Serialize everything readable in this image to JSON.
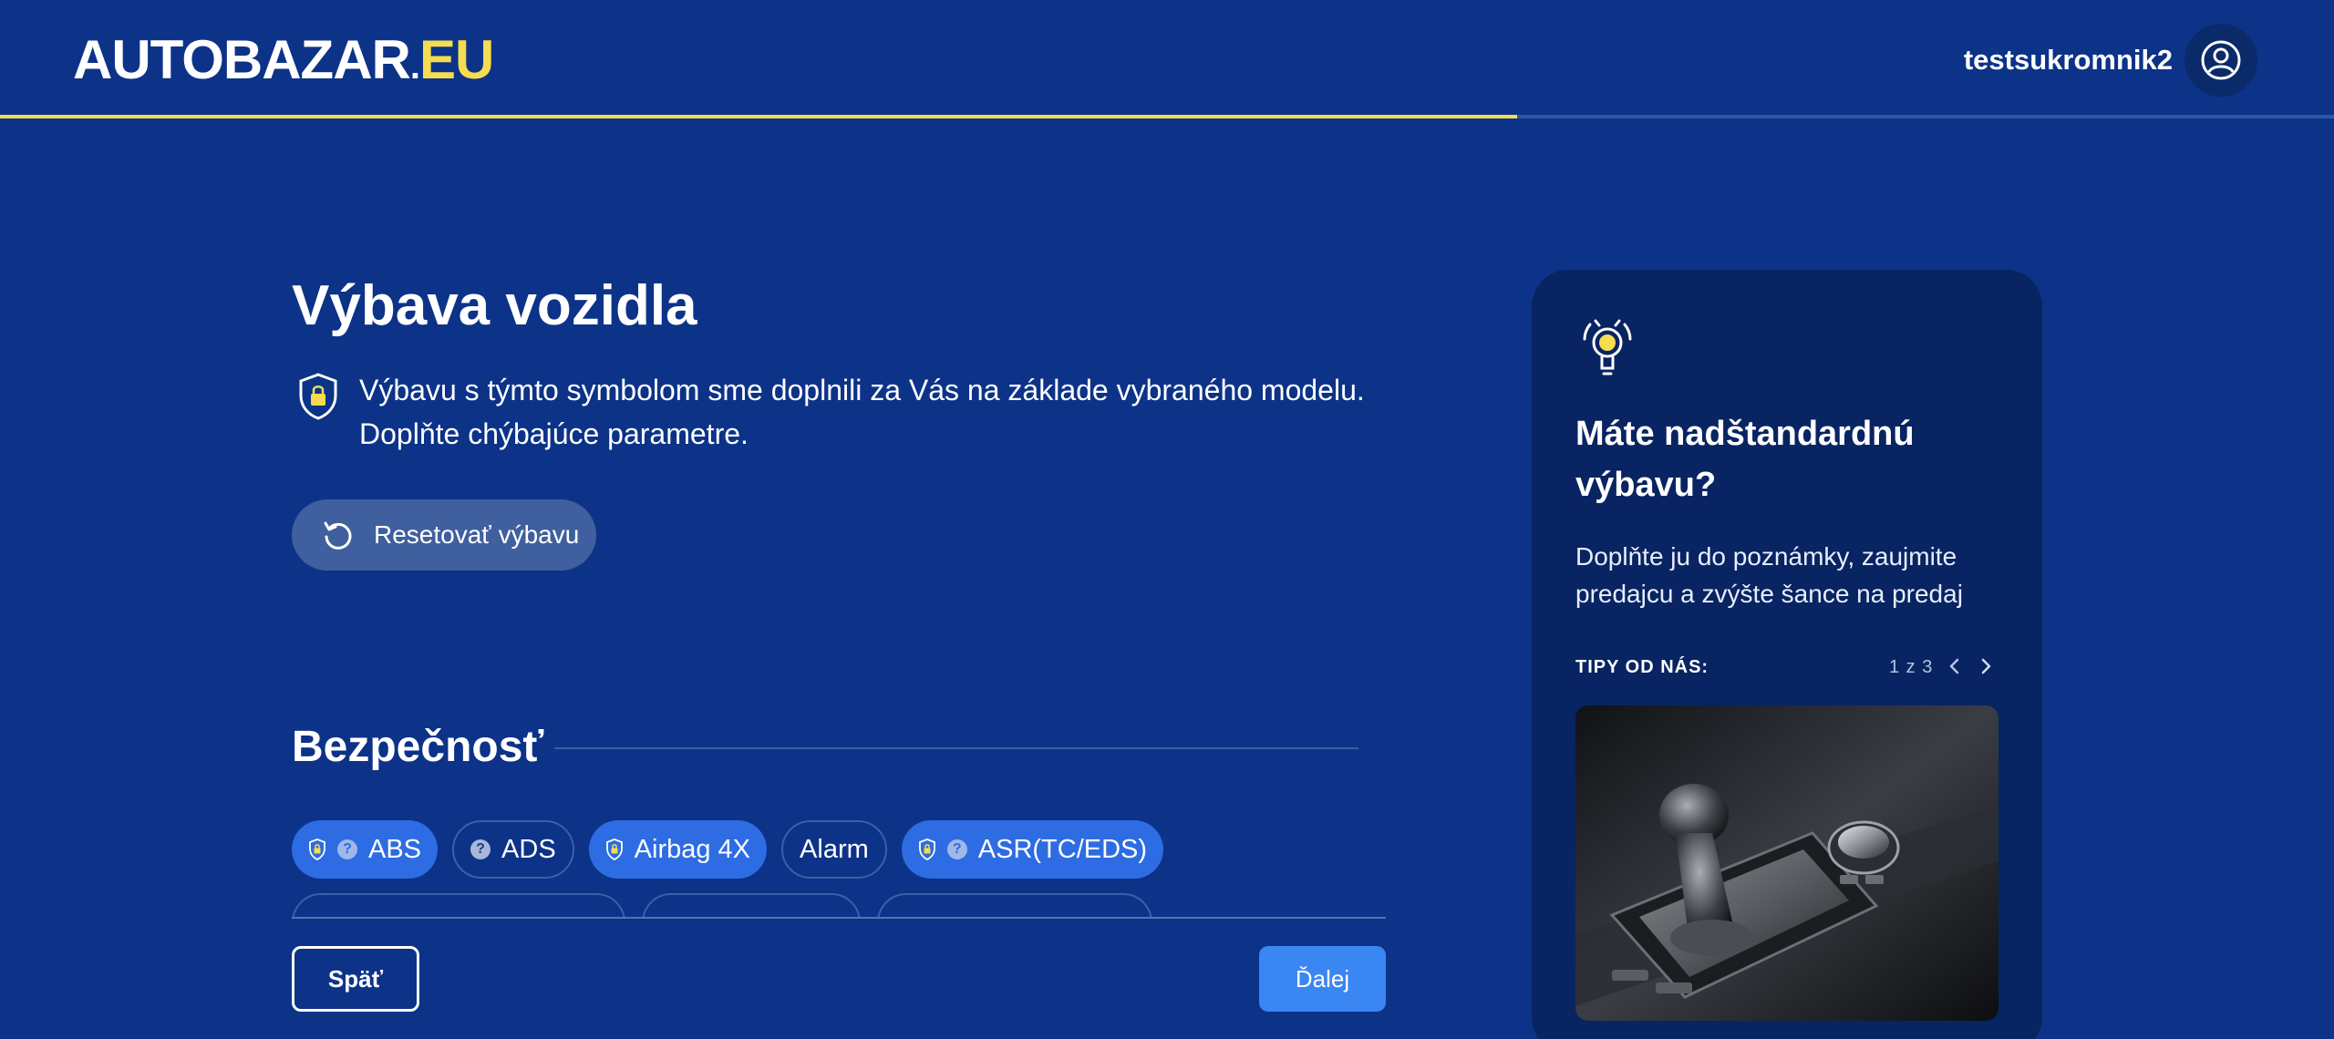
{
  "header": {
    "logo_main": "AUTOBAZAR",
    "logo_dot": ".",
    "logo_eu": "EU",
    "username": "testsukromnik2",
    "progress_fraction": 0.65
  },
  "page": {
    "title": "Výbava vozidla",
    "note_line1": "Výbavu s týmto symbolom sme doplnili za Vás na základe vybraného modelu.",
    "note_line2": "Doplňte chýbajúce parametre.",
    "reset_label": "Resetovať výbavu"
  },
  "section": {
    "title": "Bezpečnosť",
    "chips": [
      {
        "label": "ABS",
        "selected": true,
        "auto": true,
        "help": true
      },
      {
        "label": "ADS",
        "selected": false,
        "auto": false,
        "help": true
      },
      {
        "label": "Airbag 4X",
        "selected": true,
        "auto": true,
        "help": false
      },
      {
        "label": "Alarm",
        "selected": false,
        "auto": false,
        "help": false
      },
      {
        "label": "ASR(TC/EDS)",
        "selected": true,
        "auto": true,
        "help": true
      }
    ]
  },
  "nav": {
    "back_label": "Späť",
    "next_label": "Ďalej"
  },
  "tip": {
    "title_line1": "Máte nadštandardnú",
    "title_line2": "výbavu?",
    "desc_line1": "Doplňte ju do poznámky, zaujmite",
    "desc_line2": "predajcu a zvýšte šance na predaj",
    "label": "TIPY OD NÁS:",
    "count": "1 z 3",
    "icons": [
      "lightbulb-icon",
      "chevron-left-icon",
      "chevron-right-icon"
    ]
  },
  "colors": {
    "background": "#0c3388",
    "accent_yellow": "#f6dc4f",
    "chip_selected": "#2d6ce2",
    "next_button": "#3a86f3",
    "card": "#082462"
  }
}
